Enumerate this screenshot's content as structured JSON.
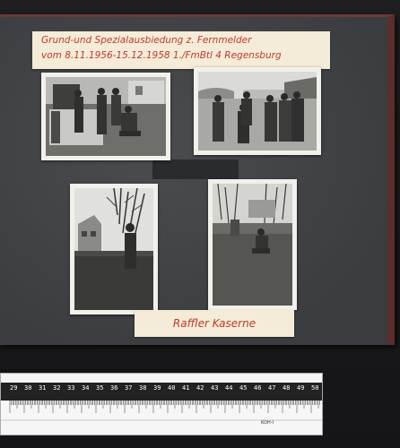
{
  "album": {
    "caption_top_line1": "Grund-und Spezialausbiedung z. Fernmelder",
    "caption_top_line2": "vom 8.11.1956-15.12.1958  1./FmBtl 4 Regensburg",
    "caption_bottom": "Raffler Kaserne"
  },
  "ruler": {
    "numbers": [
      "29",
      "30",
      "31",
      "32",
      "33",
      "34",
      "35",
      "36",
      "37",
      "38",
      "39",
      "40",
      "41",
      "42",
      "43",
      "44",
      "45",
      "46",
      "47",
      "48",
      "49",
      "50"
    ],
    "brand_mark": "KOH-I"
  },
  "colors": {
    "label_ink": "#c0392b",
    "album_page": "#3e4043",
    "album_binding": "#5a2e2a"
  }
}
